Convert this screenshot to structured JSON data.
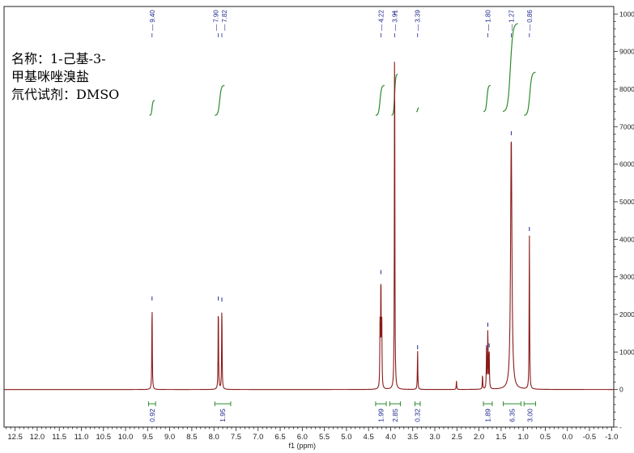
{
  "annotation": {
    "line1": "名称：1-己基-3-",
    "line2": "甲基咪唑溴盐",
    "line3": "氘代试剂：DMSO"
  },
  "chart_data": {
    "type": "line",
    "xlabel": "f1 (ppm)",
    "xlim": [
      12.75,
      -1.05
    ],
    "ylim": [
      -1000,
      10200
    ],
    "x_ticks": [
      12.5,
      12.0,
      11.5,
      11.0,
      10.5,
      10.0,
      9.5,
      9.0,
      8.5,
      8.0,
      7.5,
      7.0,
      6.5,
      6.0,
      5.5,
      5.0,
      4.5,
      4.0,
      3.5,
      3.0,
      2.5,
      2.0,
      1.5,
      1.0,
      0.5,
      0.0,
      -0.5,
      -1.0
    ],
    "y_ticks": [
      10000,
      9000,
      8000,
      7000,
      6000,
      5000,
      4000,
      3000,
      2000,
      1000,
      0
    ],
    "peak_labels": [
      "9.40",
      "7.90",
      "7.82",
      "4.22",
      "3.91",
      "3.39",
      "1.80",
      "1.27",
      "0.86"
    ],
    "peaks": [
      {
        "x": 9.4,
        "y": 2350
      },
      {
        "x": 7.9,
        "y": 2350
      },
      {
        "x": 7.82,
        "y": 2320
      },
      {
        "x": 4.24,
        "y": 1650
      },
      {
        "x": 4.22,
        "y": 3050
      },
      {
        "x": 4.2,
        "y": 1650
      },
      {
        "x": 3.91,
        "y": 9950
      },
      {
        "x": 3.39,
        "y": 1050
      },
      {
        "x": 2.51,
        "y": 230
      },
      {
        "x": 1.92,
        "y": 400
      },
      {
        "x": 1.83,
        "y": 1050
      },
      {
        "x": 1.8,
        "y": 1650
      },
      {
        "x": 1.77,
        "y": 1100
      },
      {
        "x": 1.27,
        "y": 6750
      },
      {
        "x": 0.86,
        "y": 4200
      }
    ],
    "integrals": [
      {
        "from": 9.48,
        "to": 9.32,
        "value": "0.92"
      },
      {
        "from": 7.98,
        "to": 7.62,
        "value": "1.95"
      },
      {
        "from": 4.34,
        "to": 4.1,
        "value": "1.99"
      },
      {
        "from": 4.02,
        "to": 3.78,
        "value": "2.85"
      },
      {
        "from": 3.45,
        "to": 3.33,
        "value": "0.32"
      },
      {
        "from": 1.9,
        "to": 1.7,
        "value": "1.89"
      },
      {
        "from": 1.45,
        "to": 1.05,
        "value": "6.35"
      },
      {
        "from": 0.98,
        "to": 0.72,
        "value": "3.00"
      }
    ],
    "colors": {
      "spectrum": "#8b1a1a",
      "integral": "#2e8b2e",
      "label": "#1f2a8c",
      "axis": "#222222"
    }
  }
}
